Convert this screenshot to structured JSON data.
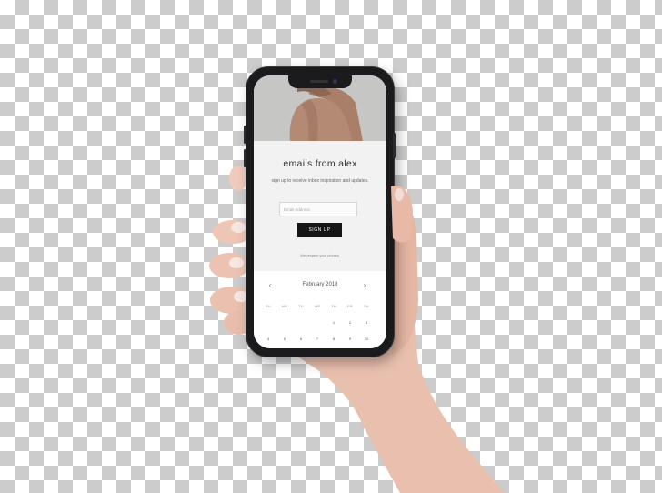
{
  "signup": {
    "title": "emails from alex",
    "subtitle": "sign up to receive inbox inspiration and updates.",
    "email_placeholder": "Email Address",
    "button_label": "SIGN UP",
    "privacy_note": "We respect your privacy."
  },
  "calendar": {
    "month_label": "February 2018",
    "prev_label": "‹",
    "next_label": "›",
    "weekdays": [
      "SU",
      "MO",
      "TU",
      "WE",
      "TH",
      "FR",
      "SA"
    ],
    "week1": [
      "",
      "",
      "",
      "",
      "1",
      "2",
      "3"
    ],
    "week2": [
      "4",
      "5",
      "6",
      "7",
      "8",
      "9",
      "10"
    ]
  },
  "colors": {
    "button_bg": "#161616",
    "signup_bg": "#f2f2f2",
    "phone_frame": "#1b1b1d"
  }
}
